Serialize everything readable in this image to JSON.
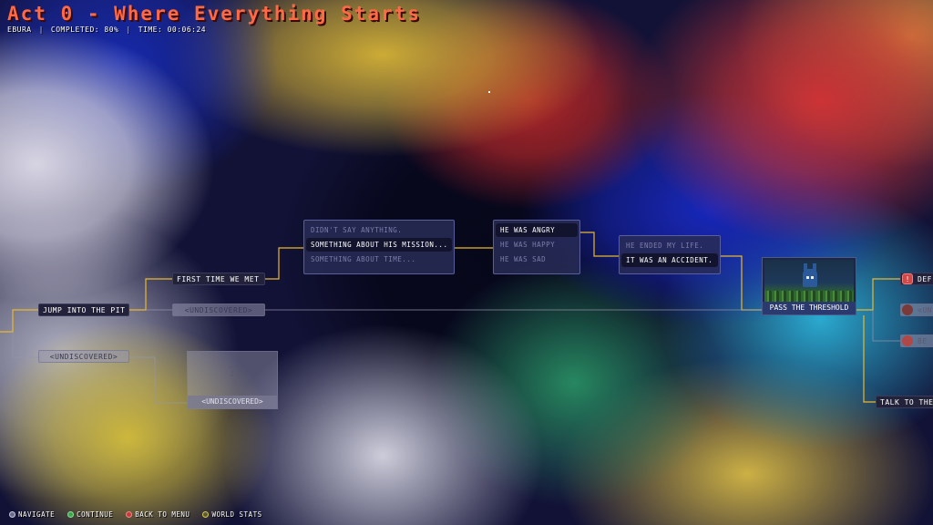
{
  "header": {
    "title": "Act 0 - Where Everything Starts",
    "character": "EBURA",
    "completed": "COMPLETED: 80%",
    "time": "TIME: 00:06:24",
    "separator": "|"
  },
  "nodes": {
    "jump_into_pit": "JUMP INTO THE PIT",
    "undiscovered_a": "<UNDISCOVERED>",
    "first_time_we_met": "FIRST TIME WE MET",
    "undiscovered_b": "<UNDISCOVERED>",
    "mystery_mark": "?",
    "undiscovered_c": "<UNDISCOVERED>",
    "pass_the_threshold": "PASS THE THRESHOLD",
    "talk_to_the": "TALK TO THE",
    "def": "DEF",
    "und": "<UN",
    "be": "BE"
  },
  "choice_groups": {
    "mission": [
      "DIDN'T SAY ANYTHING.",
      "SOMETHING ABOUT HIS MISSION...",
      "SOMETHING ABOUT TIME..."
    ],
    "feeling": [
      "HE WAS ANGRY",
      "HE WAS HAPPY",
      "HE WAS SAD"
    ],
    "ending": [
      "HE ENDED MY LIFE.",
      "IT WAS AN ACCIDENT."
    ]
  },
  "colors": {
    "title": "#ff6a45",
    "path_line": "#e8b830",
    "accent_red": "#d04848"
  },
  "footer": {
    "navigate": "NAVIGATE",
    "continue": "CONTINUE",
    "back_to_menu": "BACK TO MENU",
    "world_stats": "WORLD STATS"
  }
}
